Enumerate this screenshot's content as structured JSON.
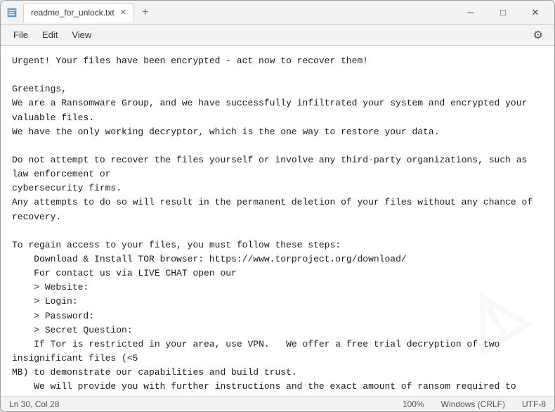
{
  "window": {
    "title": "readme_for_unlock.txt",
    "tab_label": "readme_for_unlock.txt"
  },
  "toolbar": {
    "new_tab": "+",
    "minimize": "─",
    "maximize": "□",
    "close": "✕"
  },
  "menu": {
    "file": "File",
    "edit": "Edit",
    "view": "View"
  },
  "status": {
    "position": "Ln 30, Col 28",
    "zoom": "100%",
    "line_ending": "Windows (CRLF)",
    "encoding": "UTF-8"
  },
  "content": "Urgent! Your files have been encrypted - act now to recover them!\n\nGreetings,\nWe are a Ransomware Group, and we have successfully infiltrated your system and encrypted your valuable files.\nWe have the only working decryptor, which is the one way to restore your data.\n\nDo not attempt to recover the files yourself or involve any third-party organizations, such as law enforcement or\ncybersecurity firms.\nAny attempts to do so will result in the permanent deletion of your files without any chance of recovery.\n\nTo regain access to your files, you must follow these steps:\n    Download & Install TOR browser: https://www.torproject.org/download/\n    For contact us via LIVE CHAT open our\n    > Website:\n    > Login:\n    > Password:\n    > Secret Question:\n    If Tor is restricted in your area, use VPN.   We offer a free trial decryption of two insignificant files (<5\nMB) to demonstrate our capabilities and build trust.\n    We will provide you with further instructions and the exact amount of ransom required to decrypt your files.\n    Make the payment in Bitcoin to the provided wallet address.\n    Once the payment is confirmed, we will send you the decryptor.\n\nPlease note that you have a limited time to act before the deadline expires.\nAfter that, the decryptor will be destroyed, and your files will remain encrypted forever.\nDo not ignore this message or attempt to deceive us.\nWe have already infiltrated your system, and we can easily detect any attempts to bypass our ransom demands.\n\nTake this situation seriously and act quickly to recover your files.\nWrite to us in the chat to begin the process.\n\nSincerely, Ransomware Group"
}
